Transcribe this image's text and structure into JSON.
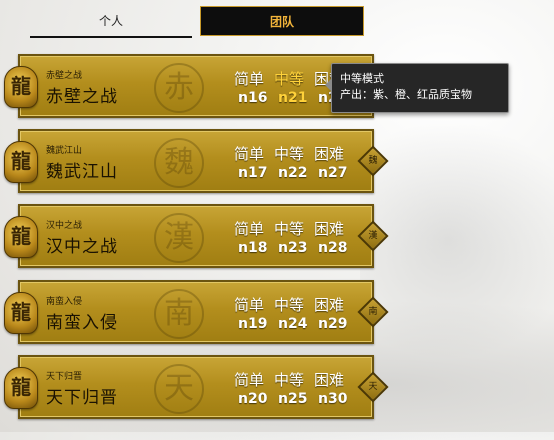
{
  "tabs": {
    "personal": "个人",
    "team": "团队"
  },
  "difficulty_labels": {
    "easy": "简单",
    "medium": "中等",
    "hard": "困难"
  },
  "levels": [
    {
      "small": "赤壁之战",
      "title": "赤壁之战",
      "seal": "赤",
      "badge": "赤",
      "codes": [
        "n16",
        "n21",
        "n26"
      ]
    },
    {
      "small": "魏武江山",
      "title": "魏武江山",
      "seal": "魏",
      "badge": "魏",
      "codes": [
        "n17",
        "n22",
        "n27"
      ]
    },
    {
      "small": "汉中之战",
      "title": "汉中之战",
      "seal": "漢",
      "badge": "漢",
      "codes": [
        "n18",
        "n23",
        "n28"
      ]
    },
    {
      "small": "南蛮入侵",
      "title": "南蛮入侵",
      "seal": "南",
      "badge": "南",
      "codes": [
        "n19",
        "n24",
        "n29"
      ]
    },
    {
      "small": "天下归晋",
      "title": "天下归晋",
      "seal": "天",
      "badge": "天",
      "codes": [
        "n20",
        "n25",
        "n30"
      ]
    }
  ],
  "dragon_glyph": "龍",
  "icons": {
    "dragon": "dragon-icon",
    "seal": "seal-icon",
    "badge": "diamond-badge-icon"
  },
  "colors": {
    "panel_gold": "#b38e1d",
    "highlight": "#ffd23a",
    "tab_active_text": "#f2b43a"
  },
  "tooltip": {
    "title": "中等模式",
    "line": "产出：紫、橙、红品质宝物"
  }
}
